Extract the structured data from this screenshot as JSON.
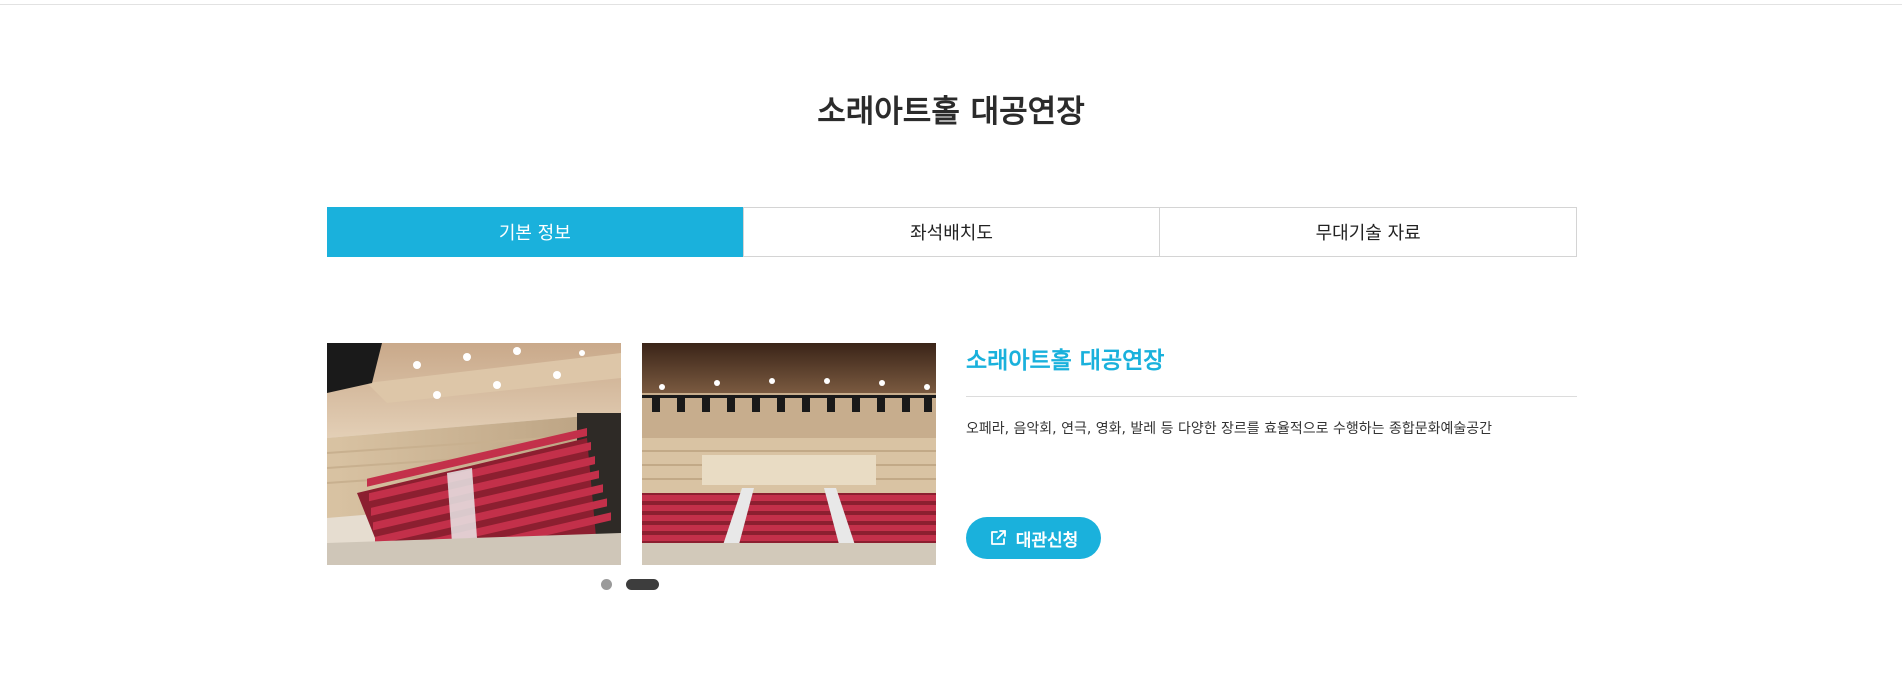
{
  "page": {
    "title": "소래아트홀 대공연장"
  },
  "tabs": [
    {
      "label": "기본 정보",
      "active": true
    },
    {
      "label": "좌석배치도",
      "active": false
    },
    {
      "label": "무대기술 자료",
      "active": false
    }
  ],
  "gallery": {
    "slides": [
      {
        "icon": "auditorium-photo-side-view"
      },
      {
        "icon": "auditorium-photo-front-view"
      }
    ],
    "pagination": {
      "current": 2,
      "total": 2
    }
  },
  "venue": {
    "name": "소래아트홀 대공연장",
    "description": "오페라, 음악회, 연극, 영화, 발레 등 다양한 장르를 효율적으로 수행하는 종합문화예술공간"
  },
  "actions": {
    "apply_label": "대관신청",
    "apply_icon": "external-link-icon"
  },
  "colors": {
    "accent": "#1ab1dc",
    "title_text": "#2b2b2b",
    "seat_red": "#b7293d"
  }
}
